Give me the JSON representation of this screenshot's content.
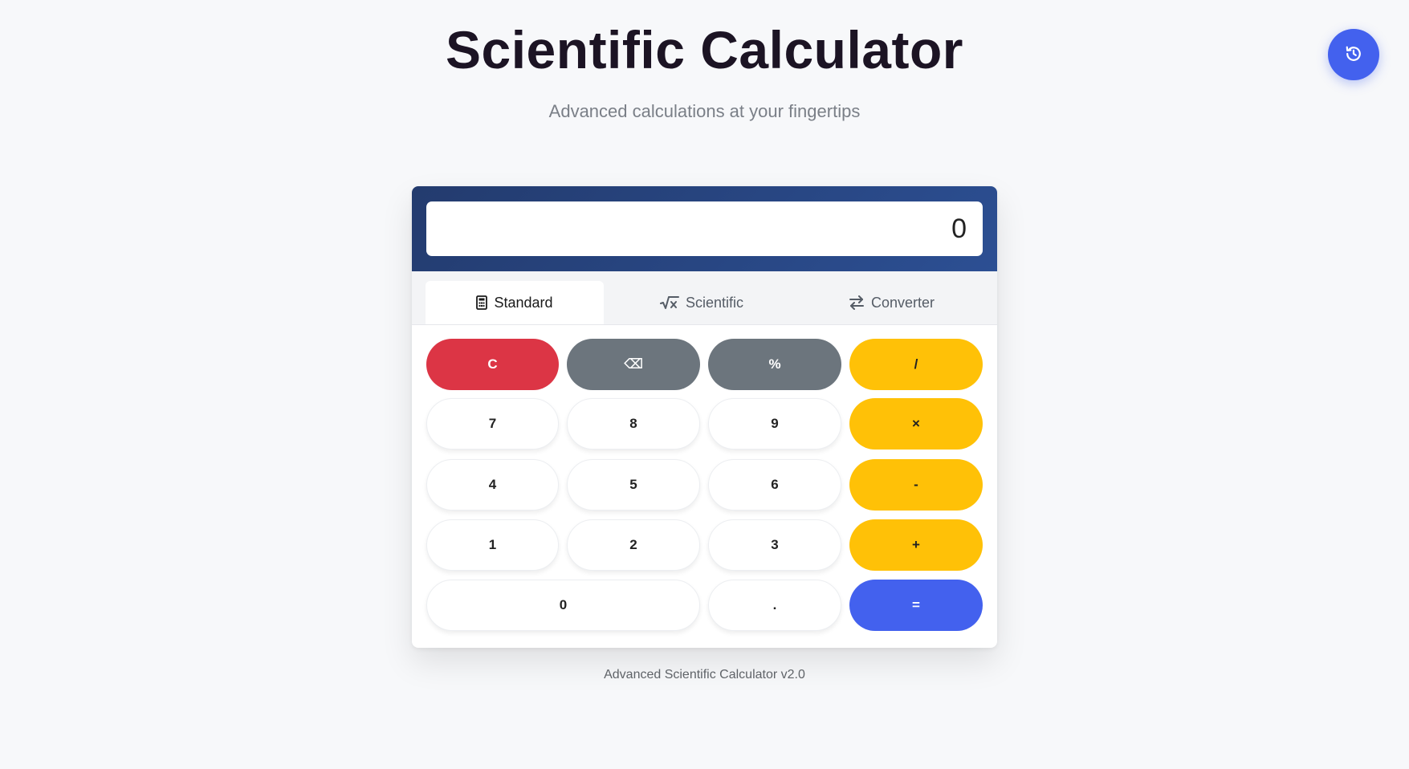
{
  "header": {
    "title": "Scientific Calculator",
    "subtitle": "Advanced calculations at your fingertips"
  },
  "history_button": {
    "icon": "history-icon",
    "color": "#4361ee"
  },
  "display": {
    "value": "0"
  },
  "tabs": [
    {
      "label": "Standard",
      "icon": "calculator-icon",
      "active": true
    },
    {
      "label": "Scientific",
      "icon": "square-root-icon",
      "active": false
    },
    {
      "label": "Converter",
      "icon": "swap-arrows-icon",
      "active": false
    }
  ],
  "keypad": {
    "clear": "C",
    "backspace": "⌫",
    "percent": "%",
    "divide": "/",
    "seven": "7",
    "eight": "8",
    "nine": "9",
    "multiply": "×",
    "four": "4",
    "five": "5",
    "six": "6",
    "subtract": "-",
    "one": "1",
    "two": "2",
    "three": "3",
    "add": "+",
    "zero": "0",
    "decimal": ".",
    "equals": "="
  },
  "colors": {
    "clear": "#dc3545",
    "function": "#6c757d",
    "operator": "#ffc107",
    "equals": "#4361ee",
    "display_header": "#2c4f93"
  },
  "footer": {
    "text": "Advanced Scientific Calculator v2.0"
  }
}
